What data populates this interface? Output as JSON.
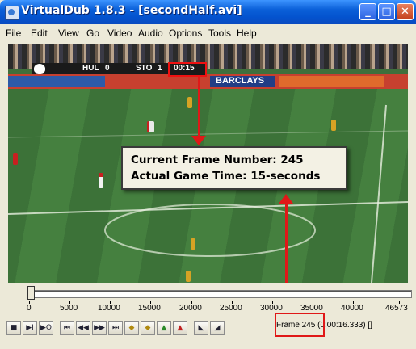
{
  "window": {
    "title": "VirtualDub 1.8.3 - [secondHalf.avi]",
    "minimize_glyph": "_",
    "maximize_glyph": "□",
    "close_glyph": "✕"
  },
  "menu": [
    "File",
    "Edit",
    "View",
    "Go",
    "Video",
    "Audio",
    "Options",
    "Tools",
    "Help"
  ],
  "video": {
    "scoreboard": {
      "home_team": "HUL",
      "home_score": "0",
      "away_team": "STO",
      "away_score": "1",
      "clock": "00:15"
    },
    "ad_boards": [
      "BARCLAYS"
    ]
  },
  "annotation": {
    "line1": "Current Frame Number: 245",
    "line2": "Actual Game Time: 15-seconds",
    "color": "#e01818"
  },
  "timeline": {
    "tick_labels": [
      "0",
      "5000",
      "10000",
      "15000",
      "20000",
      "25000",
      "30000",
      "35000",
      "40000",
      "46573"
    ],
    "position_fraction": 0.005
  },
  "toolbar": {
    "buttons": [
      {
        "name": "stop-button",
        "glyph": "■"
      },
      {
        "name": "play-input-button",
        "glyph": "▶I"
      },
      {
        "name": "play-output-button",
        "glyph": "▶O"
      },
      {
        "name": "go-start-button",
        "glyph": "⏮"
      },
      {
        "name": "step-back-button",
        "glyph": "◀◀"
      },
      {
        "name": "step-forward-button",
        "glyph": "▶▶"
      },
      {
        "name": "go-end-button",
        "glyph": "⏭"
      },
      {
        "name": "prev-keyframe-button",
        "glyph": "◆"
      },
      {
        "name": "next-keyframe-button",
        "glyph": "◆"
      },
      {
        "name": "scene-back-button",
        "glyph": "▲"
      },
      {
        "name": "scene-forward-button",
        "glyph": "▲"
      },
      {
        "name": "mark-in-button",
        "glyph": "◣"
      },
      {
        "name": "mark-out-button",
        "glyph": "◢"
      }
    ],
    "status": "Frame 245 (0:00:16.333) []"
  }
}
